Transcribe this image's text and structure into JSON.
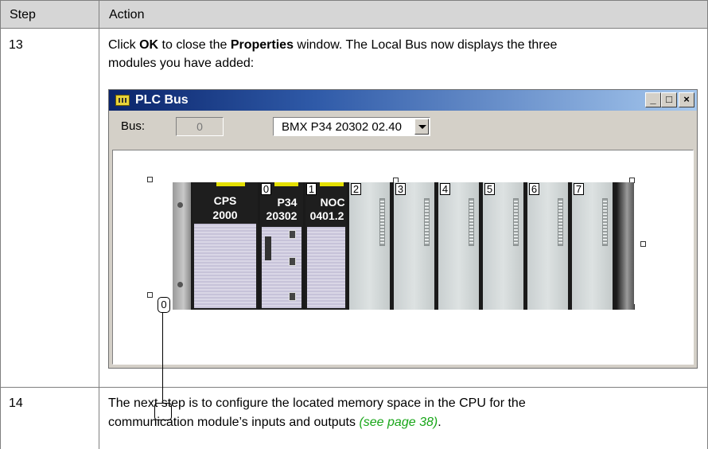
{
  "table": {
    "headers": {
      "step": "Step",
      "action": "Action"
    },
    "rows": [
      {
        "step": "13",
        "action_parts": {
          "p1": "Click ",
          "ok": "OK",
          "p2": " to close the ",
          "properties": "Properties",
          "p3": " window. The Local Bus now displays the three",
          "line2": "modules you have added:"
        }
      },
      {
        "step": "14",
        "action_parts": {
          "line1": "The next step is to configure the located memory space in the CPU for the",
          "line2_pre": "communication module’s inputs and outputs ",
          "link": "(see page 38)",
          "line2_post": "."
        }
      }
    ]
  },
  "window": {
    "title": "PLC Bus",
    "buttons": {
      "minimize": "_",
      "maximize": "□",
      "close": "×"
    },
    "bus_label": "Bus:",
    "bus_value": "0",
    "processor_selected": "BMX P34 20302 02.40",
    "colors": {
      "title_start": "#0a246a",
      "title_end": "#a6c8ee",
      "chrome": "#d4d0c8",
      "slot_label": "#e4e000"
    }
  },
  "rack": {
    "power_module": {
      "line1": "CPS",
      "line2": "2000"
    },
    "modules": [
      {
        "slot": "0",
        "line1": "P34",
        "line2": "20302"
      },
      {
        "slot": "1",
        "line1": "NOC",
        "line2": "0401.2"
      }
    ],
    "empty_slots": [
      "2",
      "3",
      "4",
      "5",
      "6",
      "7"
    ],
    "bus_node": "0"
  }
}
